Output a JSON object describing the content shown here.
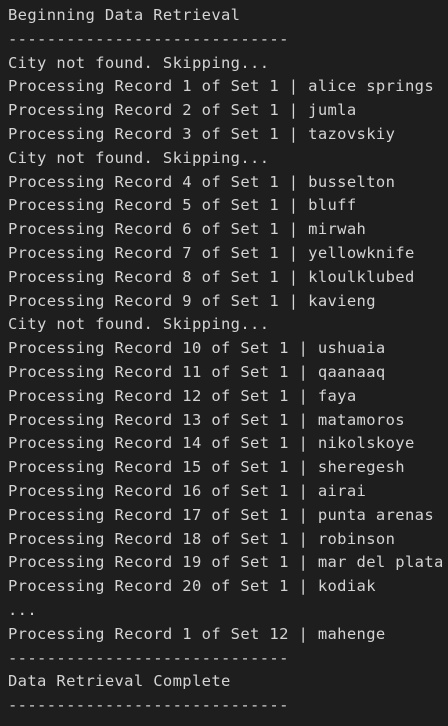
{
  "console": {
    "lines": [
      "Beginning Data Retrieval",
      "-----------------------------",
      "City not found. Skipping...",
      "Processing Record 1 of Set 1 | alice springs",
      "Processing Record 2 of Set 1 | jumla",
      "Processing Record 3 of Set 1 | tazovskiy",
      "City not found. Skipping...",
      "Processing Record 4 of Set 1 | busselton",
      "Processing Record 5 of Set 1 | bluff",
      "Processing Record 6 of Set 1 | mirwah",
      "Processing Record 7 of Set 1 | yellowknife",
      "Processing Record 8 of Set 1 | kloulklubed",
      "Processing Record 9 of Set 1 | kavieng",
      "City not found. Skipping...",
      "Processing Record 10 of Set 1 | ushuaia",
      "Processing Record 11 of Set 1 | qaanaaq",
      "Processing Record 12 of Set 1 | faya",
      "Processing Record 13 of Set 1 | matamoros",
      "Processing Record 14 of Set 1 | nikolskoye",
      "Processing Record 15 of Set 1 | sheregesh",
      "Processing Record 16 of Set 1 | airai",
      "Processing Record 17 of Set 1 | punta arenas",
      "Processing Record 18 of Set 1 | robinson",
      "Processing Record 19 of Set 1 | mar del plata",
      "Processing Record 20 of Set 1 | kodiak",
      "...",
      "Processing Record 1 of Set 12 | mahenge",
      "-----------------------------",
      "Data Retrieval Complete",
      "-----------------------------"
    ]
  }
}
